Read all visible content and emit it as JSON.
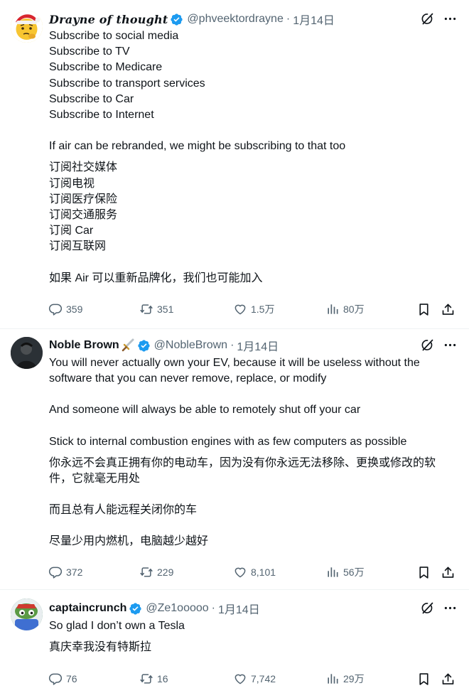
{
  "colors": {
    "text": "#0f1419",
    "secondary": "#536471",
    "verified": "#1d9bf0",
    "divider": "#eff3f4"
  },
  "tweets": [
    {
      "author": "Drayne of thought",
      "handle": "@phveektordrayne",
      "date": "1月14日",
      "lines_en": [
        "Subscribe to social media",
        "Subscribe to TV",
        "Subscribe to Medicare",
        "Subscribe to transport services",
        "Subscribe to Car",
        "Subscribe to Internet"
      ],
      "para_en": "If air can be rebranded, we might be subscribing to that too",
      "lines_zh": [
        "订阅社交媒体",
        "订阅电视",
        "订阅医疗保险",
        "订阅交通服务",
        "订阅 Car",
        "订阅互联网"
      ],
      "para_zh": "如果 Air 可以重新品牌化，我们也可能加入",
      "replies": "359",
      "reposts": "351",
      "likes": "1.5万",
      "views": "80万"
    },
    {
      "author": "Noble Brown",
      "handle": "@NobleBrown",
      "date": "1月14日",
      "text_en_1": "You will never actually own your EV, because it will be useless without the software that you can never remove, replace, or modify",
      "text_en_2": "And someone will always be able to remotely shut off your car",
      "text_en_3": "Stick to internal combustion engines with as few computers as possible",
      "text_zh_1": "你永远不会真正拥有你的电动车，因为没有你永远无法移除、更换或修改的软件，它就毫无用处",
      "text_zh_2": "而且总有人能远程关闭你的车",
      "text_zh_3": "尽量少用内燃机，电脑越少越好",
      "replies": "372",
      "reposts": "229",
      "likes": "8,101",
      "views": "56万"
    },
    {
      "author": "captaincrunch",
      "handle": "@Ze1ooooo",
      "date": "1月14日",
      "text_en": "So glad I don’t own a Tesla",
      "text_zh": "真庆幸我没有特斯拉",
      "replies": "76",
      "reposts": "16",
      "likes": "7,742",
      "views": "29万"
    }
  ],
  "separator": "·",
  "icons": [
    "grok-icon",
    "more-icon",
    "reply-icon",
    "repost-icon",
    "like-icon",
    "views-icon",
    "bookmark-icon",
    "share-icon",
    "verified-badge-icon",
    "sword-emoji-icon"
  ]
}
